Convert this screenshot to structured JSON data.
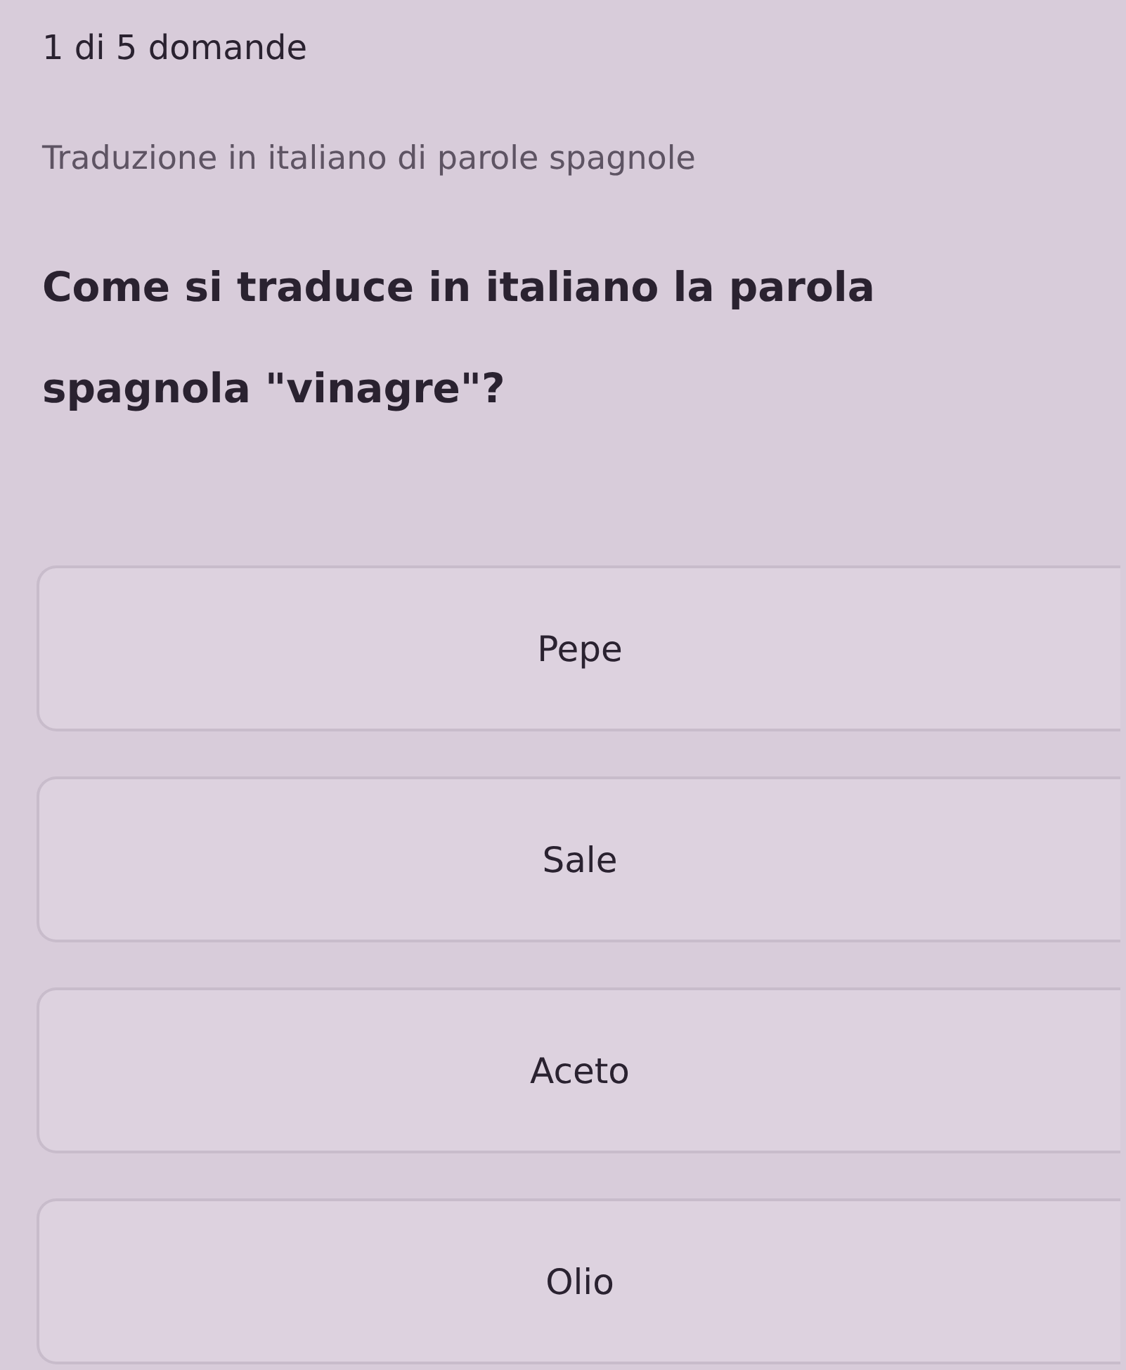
{
  "progress": "1 di 5 domande",
  "subtitle": "Traduzione in italiano di parole spagnole",
  "question": "Come si traduce in italiano la parola spagnola \"vinagre\"?",
  "options": [
    {
      "label": "Pepe"
    },
    {
      "label": "Sale"
    },
    {
      "label": "Aceto"
    },
    {
      "label": "Olio"
    }
  ]
}
